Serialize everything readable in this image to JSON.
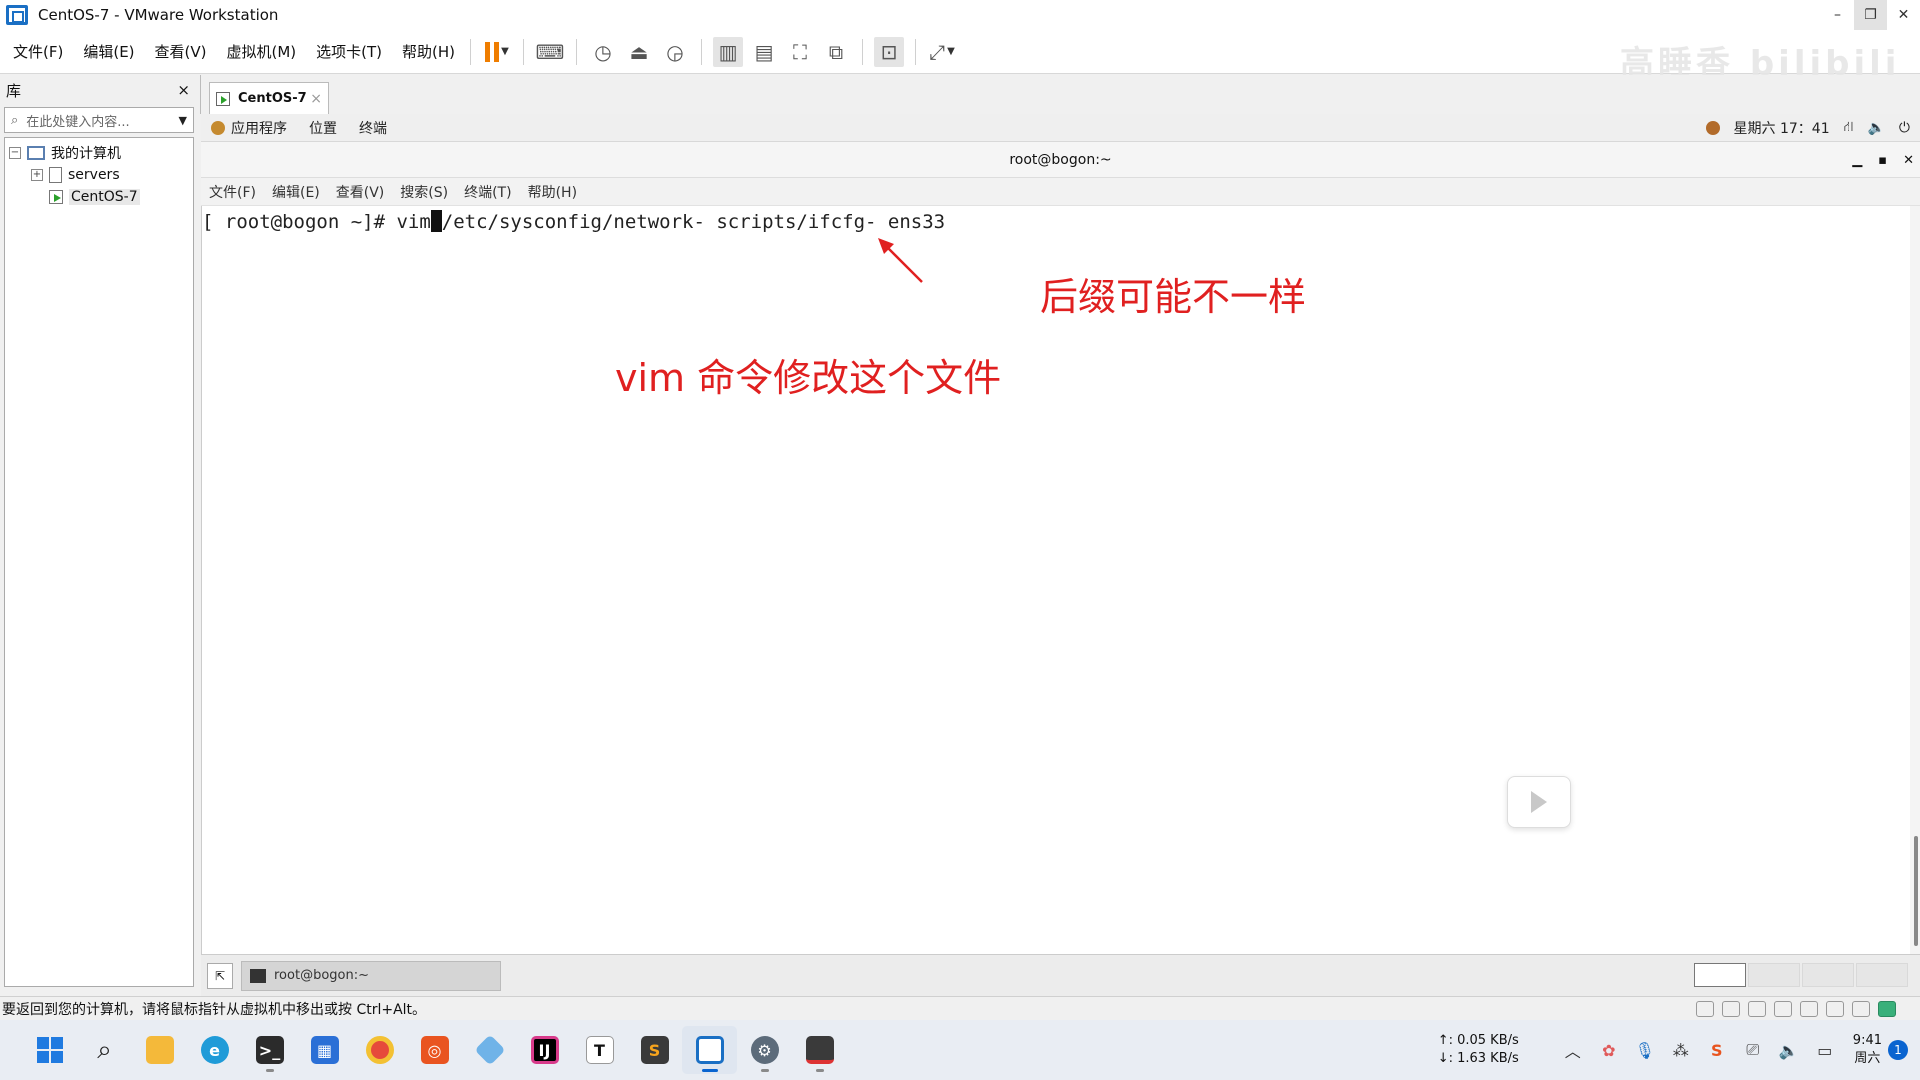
{
  "window": {
    "title": "CentOS-7 - VMware Workstation",
    "min_glyph": "–",
    "restore_glyph": "❐",
    "close_glyph": "✕"
  },
  "menubar": {
    "items": [
      "文件(F)",
      "编辑(E)",
      "查看(V)",
      "虚拟机(M)",
      "选项卡(T)",
      "帮助(H)"
    ]
  },
  "library": {
    "title": "库",
    "close_glyph": "×",
    "search_placeholder": "在此处键入内容...",
    "tree": {
      "root": "我的计算机",
      "children": [
        "servers",
        "CentOS-7"
      ]
    }
  },
  "vm_tab": {
    "label": "CentOS-7",
    "close_glyph": "×"
  },
  "gnome": {
    "top_menu": [
      "应用程序",
      "位置",
      "终端"
    ],
    "clock": "星期六 17：41",
    "terminal_title": "root@bogon:~",
    "terminal_menu": [
      "文件(F)",
      "编辑(E)",
      "查看(V)",
      "搜索(S)",
      "终端(T)",
      "帮助(H)"
    ],
    "prompt": "[ root@bogon ~]# ",
    "cmd_before_cursor": "vim",
    "cmd_after_cursor": "/etc/sysconfig/network- scripts/ifcfg- ens33",
    "taskbar_item": "root@bogon:~",
    "workspaces": 4,
    "active_workspace": 1
  },
  "annotations": {
    "suffix_note": "后缀可能不一样",
    "vim_note": "vim 命令修改这个文件",
    "color": "#e02020"
  },
  "statusbar": {
    "message": "要返回到您的计算机，请将鼠标指针从虚拟机中移出或按 Ctrl+Alt。"
  },
  "taskbar": {
    "apps": [
      "start-icon",
      "search-icon",
      "file-explorer-icon",
      "edge-icon",
      "terminal-icon",
      "store-icon",
      "chrome-icon",
      "ubuntu-icon",
      "sourcetree-icon",
      "intellij-icon",
      "typora-icon",
      "sublime-icon",
      "vmware-icon",
      "settings-icon",
      "snipping-icon"
    ],
    "net_up": "↑: 0.05 KB/s",
    "net_down": "↓: 1.63 KB/s",
    "time": "9:41",
    "day": "周六",
    "notifications": "1"
  },
  "watermark": "高睡香 bilibili"
}
